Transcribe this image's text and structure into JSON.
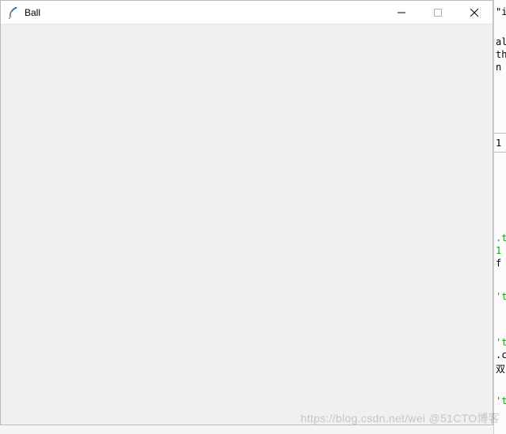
{
  "window": {
    "title": "Ball",
    "icon_name": "tk-feather-icon",
    "controls": {
      "minimize_label": "Minimize",
      "maximize_label": "Maximize",
      "close_label": "Close"
    }
  },
  "background_fragments": {
    "f0": "\"i",
    "f1": "al",
    "f2": "th",
    "f3": "n",
    "f4": "1",
    "f5": ".t",
    "f6": "1",
    "f7": "f",
    "f8": "'t",
    "f9": "'t",
    "f10": ".c",
    "f11": "双",
    "f12": "'t"
  },
  "watermark": {
    "text": "https://blog.csdn.net/wei @51CTO博客"
  }
}
